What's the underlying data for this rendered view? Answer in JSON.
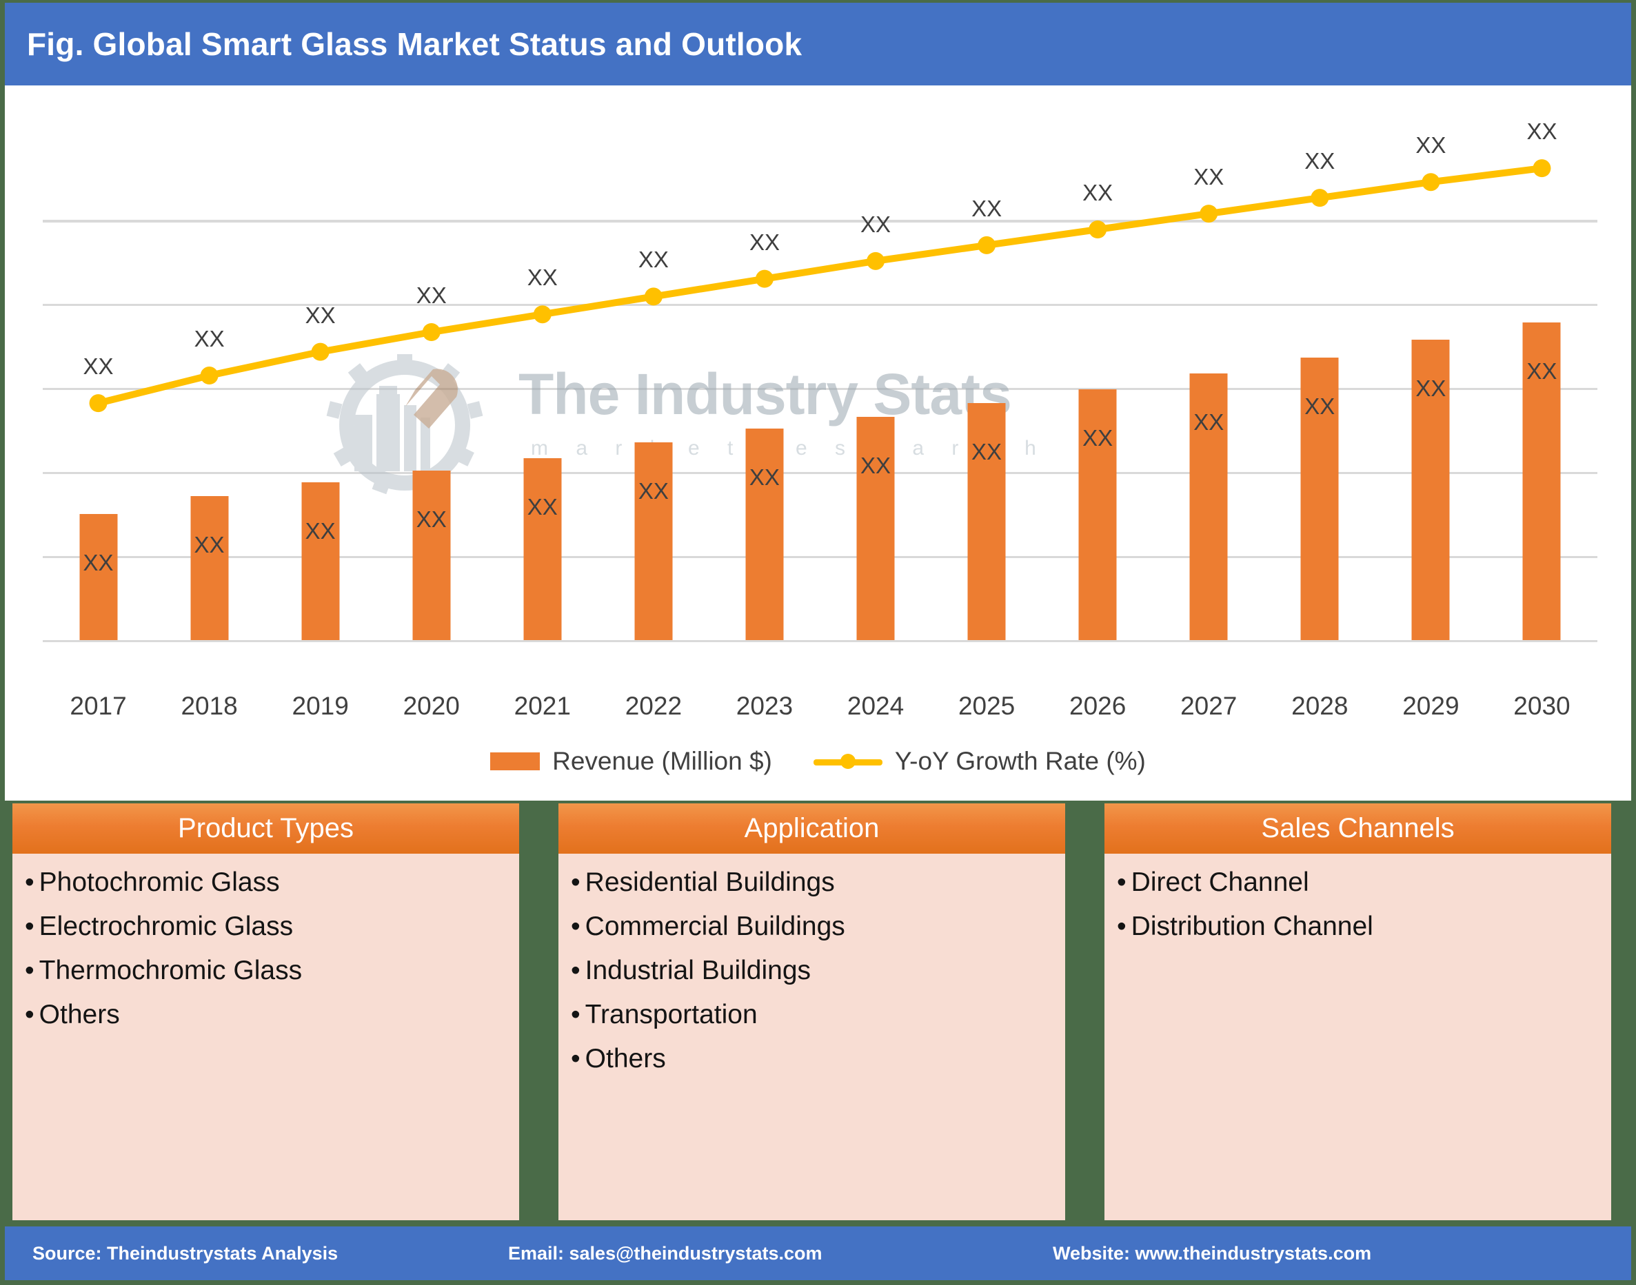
{
  "header": {
    "title": "Fig. Global Smart Glass Market Status and Outlook"
  },
  "watermark": {
    "brand": "The Industry Stats",
    "tagline": "m a r k e t   r e s e a r c h",
    "logo_icon": "gear-buildings-wrench-icon"
  },
  "chart_data": {
    "type": "bar",
    "title": "Fig. Global Smart Glass Market Status and Outlook",
    "xlabel": "",
    "ylabel": "",
    "grid": true,
    "legend_position": "bottom",
    "categories": [
      "2017",
      "2018",
      "2019",
      "2020",
      "2021",
      "2022",
      "2023",
      "2024",
      "2025",
      "2026",
      "2027",
      "2028",
      "2029",
      "2030"
    ],
    "series": [
      {
        "name": "Revenue (Million $)",
        "type": "bar",
        "color": "#ED7D31",
        "values": [
          64,
          73,
          80,
          86,
          92,
          100,
          107,
          113,
          120,
          127,
          135,
          143,
          152,
          161
        ],
        "value_labels": [
          "XX",
          "XX",
          "XX",
          "XX",
          "XX",
          "XX",
          "XX",
          "XX",
          "XX",
          "XX",
          "XX",
          "XX",
          "XX",
          "XX"
        ]
      },
      {
        "name": "Y-oY Growth Rate (%)",
        "type": "line",
        "color": "#FFC000",
        "values": [
          120,
          134,
          146,
          156,
          165,
          174,
          183,
          192,
          200,
          208,
          216,
          224,
          232,
          239
        ],
        "value_labels": [
          "XX",
          "XX",
          "XX",
          "XX",
          "XX",
          "XX",
          "XX",
          "XX",
          "XX",
          "XX",
          "XX",
          "XX",
          "XX",
          "XX"
        ]
      }
    ]
  },
  "legend": [
    {
      "label": "Revenue (Million $)",
      "marker": "bar-swatch",
      "color": "#ED7D31"
    },
    {
      "label": "Y-oY Growth Rate (%)",
      "marker": "line-marker",
      "color": "#FFC000"
    }
  ],
  "panels": [
    {
      "title": "Product Types",
      "items": [
        "Photochromic Glass",
        "Electrochromic Glass",
        "Thermochromic Glass",
        "Others"
      ]
    },
    {
      "title": "Application",
      "items": [
        "Residential Buildings",
        "Commercial Buildings",
        "Industrial Buildings",
        "Transportation",
        "Others"
      ]
    },
    {
      "title": "Sales Channels",
      "items": [
        "Direct Channel",
        "Distribution Channel"
      ]
    }
  ],
  "footer": {
    "source": "Source: Theindustrystats Analysis",
    "email": "Email: sales@theindustrystats.com",
    "website": "Website: www.theindustrystats.com"
  },
  "colors": {
    "header_blue": "#4472c4",
    "bar_orange": "#ED7D31",
    "line_yellow": "#FFC000",
    "panel_body_pink": "#F8DDD3",
    "frame_green": "#4a6b48"
  }
}
